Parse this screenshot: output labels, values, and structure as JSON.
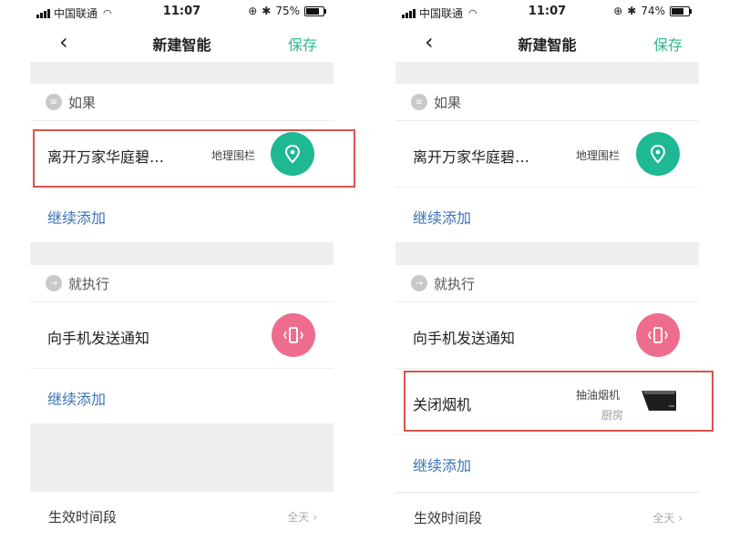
{
  "status": {
    "carrier": "中国联通",
    "time": "11:07",
    "battery_left": "75%",
    "battery_right": "74%",
    "battery_level_left": 0.75,
    "battery_level_right": 0.74
  },
  "nav": {
    "title": "新建智能",
    "save": "保存",
    "back_icon": "chevron-left-icon"
  },
  "if_section": {
    "label": "如果",
    "icon": "list-icon",
    "condition": {
      "title": "离开万家华庭碧…",
      "type": "地理围栏",
      "icon": "location-pin-icon"
    },
    "continue": "继续添加"
  },
  "then_section": {
    "label": "就执行",
    "icon": "arrow-right-icon",
    "action_notify": {
      "title": "向手机发送通知",
      "icon": "phone-vibrate-icon"
    },
    "action_hood": {
      "title": "关闭烟机",
      "device": "抽油烟机",
      "room": "厨房"
    },
    "continue": "继续添加"
  },
  "footer": {
    "label": "生效时间段",
    "value": "全天"
  },
  "colors": {
    "accent_green": "#1fb895",
    "accent_pink": "#ee6c8d",
    "link_blue": "#3a73b8",
    "highlight_red": "#d9534f"
  }
}
